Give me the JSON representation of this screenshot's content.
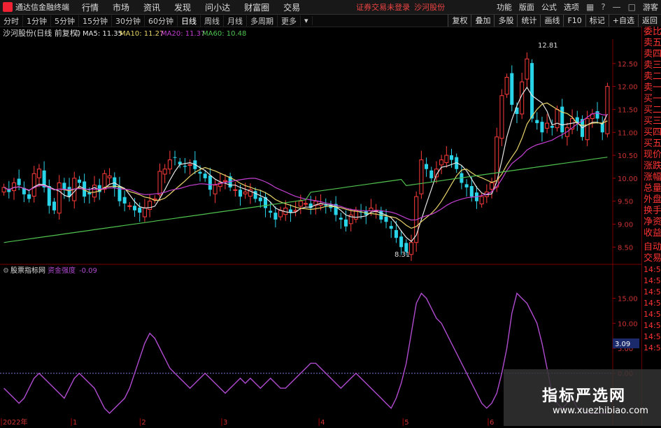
{
  "app": {
    "name": "通达信金融终端",
    "menu": [
      "行情",
      "市场",
      "资讯",
      "发现",
      "问小达",
      "财富圈",
      "交易"
    ],
    "notice": "证券交易未登录",
    "stock_link": "沙河股份",
    "right_menu": [
      "功能",
      "版面",
      "公式",
      "选项"
    ],
    "guest": "游客"
  },
  "toolbar": {
    "periods": [
      "分时",
      "1分钟",
      "5分钟",
      "15分钟",
      "30分钟",
      "60分钟",
      "日线",
      "周线",
      "月线",
      "多周期",
      "更多"
    ],
    "active_period": "日线",
    "right_tools": [
      "复权",
      "叠加",
      "多股",
      "统计",
      "画线",
      "F10",
      "标记",
      "+自选",
      "返回"
    ]
  },
  "kline": {
    "title": "沙河股份(日线 前复权)",
    "ma5_label": "MA5: 11.35",
    "ma10_label": "MA10: 11.27",
    "ma20_label": "MA20: 11.37",
    "ma60_label": "MA60: 10.48",
    "high_label": "12.81",
    "low_label": "8.31",
    "colors": {
      "up": "#ff3b3b",
      "down": "#29d4e8",
      "ma5": "#e6e6e6",
      "ma10": "#e8d46a",
      "ma20": "#c23fd0",
      "ma60": "#4fc24f"
    }
  },
  "indicator": {
    "title": "股票指标网",
    "line_label": "资金强度",
    "line_value": "-0.09",
    "current_value": "3.09",
    "line_color": "#b04bd0"
  },
  "x_labels": [
    "2022年",
    "1",
    "2",
    "3",
    "4",
    "5",
    "6"
  ],
  "sidebar": [
    "委比",
    "卖五",
    "卖四",
    "卖三",
    "卖二",
    "卖一",
    "买一",
    "买二",
    "买三",
    "买四",
    "买五",
    "现价",
    "涨跌",
    "涨幅",
    "总量",
    "外盘",
    "换手",
    "净资",
    "收益"
  ],
  "sidebar_lower": [
    "自动",
    "交易",
    "14:5",
    "14:5",
    "14:5",
    "14:5",
    "14:5",
    "14:5",
    "14:5",
    "14:5"
  ],
  "watermark": {
    "cn": "指标严选网",
    "url": "www.xuezhibiao.com"
  },
  "chart_data": [
    {
      "type": "candlestick",
      "title": "沙河股份(日线 前复权)",
      "y_ticks": [
        8.5,
        9.0,
        9.5,
        10.0,
        10.5,
        11.0,
        11.5,
        12.0,
        12.5
      ],
      "ylim": [
        8.2,
        13.0
      ],
      "x_labels": [
        "2022年",
        "1",
        "2",
        "3",
        "4",
        "5",
        "6"
      ],
      "close": [
        9.8,
        9.7,
        9.9,
        9.85,
        9.65,
        9.55,
        10.1,
        10.2,
        9.8,
        9.4,
        9.3,
        9.9,
        9.75,
        9.6,
        10.0,
        9.9,
        9.6,
        9.65,
        9.85,
        9.7,
        10.1,
        10.05,
        9.8,
        9.5,
        9.45,
        9.4,
        9.3,
        9.25,
        9.35,
        9.5,
        9.55,
        10.15,
        10.2,
        10.4,
        10.45,
        10.3,
        10.25,
        10.3,
        10.2,
        10.1,
        10.0,
        9.75,
        9.85,
        9.9,
        9.95,
        9.8,
        9.75,
        9.6,
        9.7,
        9.75,
        9.55,
        9.5,
        9.35,
        9.25,
        9.1,
        9.3,
        9.35,
        9.25,
        9.3,
        9.5,
        9.45,
        9.35,
        9.5,
        9.45,
        9.4,
        9.35,
        9.2,
        9.1,
        8.95,
        9.2,
        9.3,
        9.25,
        9.2,
        9.35,
        9.3,
        9.1,
        9.05,
        8.9,
        8.7,
        8.5,
        8.4,
        8.6,
        9.6,
        10.4,
        10.2,
        10.0,
        10.2,
        10.4,
        10.5,
        10.4,
        10.2,
        9.9,
        9.8,
        9.6,
        9.5,
        9.6,
        9.7,
        9.9,
        10.9,
        11.8,
        12.2,
        11.6,
        11.4,
        12.1,
        12.6,
        11.3,
        11.2,
        11.0,
        11.2,
        11.1,
        11.5,
        11.0,
        11.1,
        11.3,
        11.2,
        10.9,
        11.3,
        11.4,
        11.3,
        11.0,
        12.0
      ],
      "ma_labels": [
        "MA5: 11.35",
        "MA10: 11.27",
        "MA20: 11.37",
        "MA60: 10.48"
      ],
      "annotations": [
        "12.81",
        "8.31"
      ]
    },
    {
      "type": "line",
      "title": "资金强度",
      "y_ticks": [
        0.0,
        5.0,
        10.0,
        15.0
      ],
      "ylim": [
        -9,
        19
      ],
      "values": [
        -3,
        -4,
        -5,
        -6,
        -5,
        -3,
        -1,
        0,
        -1,
        -2,
        -3,
        -4,
        -5,
        -3,
        -1,
        0,
        -1,
        -2,
        -3,
        -5,
        -7,
        -8,
        -7,
        -6,
        -5,
        -3,
        0,
        3,
        6,
        8,
        7,
        5,
        3,
        1,
        0,
        -1,
        -2,
        -3,
        -2,
        -1,
        0,
        -1,
        -2,
        -3,
        -4,
        -3,
        -2,
        -1,
        -2,
        -1,
        -2,
        -3,
        -2,
        -1,
        -2,
        -3,
        -3,
        -2,
        -1,
        0,
        1,
        2,
        2,
        1,
        0,
        -1,
        -2,
        -3,
        -2,
        -1,
        0,
        -1,
        -2,
        -3,
        -4,
        -5,
        -6,
        -7,
        -5,
        -2,
        2,
        8,
        14,
        16,
        15,
        13,
        11,
        10,
        8,
        6,
        4,
        2,
        0,
        -2,
        -4,
        -6,
        -7,
        -6,
        -4,
        0,
        5,
        12,
        16,
        15,
        14,
        12,
        10,
        6,
        1,
        -4,
        -6,
        -7,
        -6,
        -5,
        -7,
        -7,
        -8,
        -8,
        -8,
        -8,
        -8
      ],
      "current": 3.09,
      "legend": "资金强度 -0.09"
    }
  ]
}
